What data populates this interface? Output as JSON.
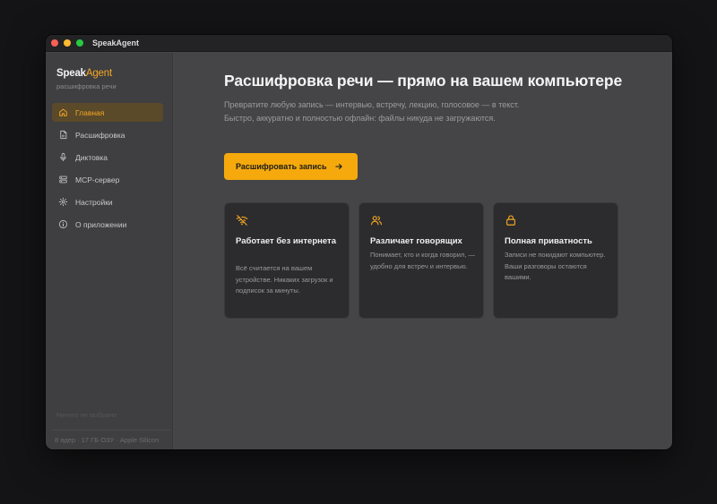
{
  "window": {
    "title": "SpeakAgent"
  },
  "brand": {
    "name_part1": "Speak",
    "name_part2": "Agent",
    "subtitle": "расшифровка речи"
  },
  "colors": {
    "accent": "#f5a623",
    "button": "#f5a90c",
    "card_bg": "#2c2c2e"
  },
  "sidebar": {
    "items": [
      {
        "label": "Главная",
        "icon": "home-icon",
        "active": true
      },
      {
        "label": "Расшифровка",
        "icon": "document-audio-icon",
        "active": false
      },
      {
        "label": "Диктовка",
        "icon": "microphone-icon",
        "active": false
      },
      {
        "label": "MCP-сервер",
        "icon": "server-icon",
        "active": false
      },
      {
        "label": "Настройки",
        "icon": "gear-icon",
        "active": false
      },
      {
        "label": "О приложении",
        "icon": "info-icon",
        "active": false
      }
    ],
    "footer_hint": "Ничего не выбрано",
    "system_info": "8 ядер · 17 ГБ ОЗУ · Apple Silicon"
  },
  "main": {
    "heading": "Расшифровка речи — прямо на вашем компьютере",
    "lead": "Превратите любую запись — интервью, встречу, лекцию, голосовое — в текст. Быстро, аккуратно и полностью офлайн: файлы никуда не загружаются.",
    "cta_label": "Расшифровать запись",
    "features": [
      {
        "icon": "wifi-off-icon",
        "title": "Работает без интернета",
        "desc": "Всё считается на вашем устройстве. Никаких загрузок и подписок за минуты."
      },
      {
        "icon": "users-icon",
        "title": "Различает говорящих",
        "desc": "Понимает, кто и когда говорил, — удобно для встреч и интервью."
      },
      {
        "icon": "lock-icon",
        "title": "Полная приватность",
        "desc": "Записи не покидают компьютер. Ваши разговоры остаются вашими."
      }
    ]
  }
}
